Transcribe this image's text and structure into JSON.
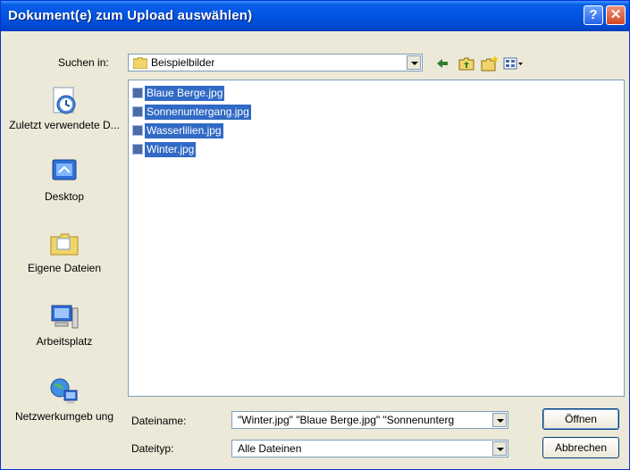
{
  "window": {
    "title": "Dokument(e) zum Upload auswählen)",
    "help_label": "?",
    "close_label": "✕"
  },
  "lookin": {
    "label": "Suchen in:",
    "value": "Beispielbilder"
  },
  "places": [
    {
      "label": "Zuletzt verwendete D...",
      "icon": "recent-documents-icon"
    },
    {
      "label": "Desktop",
      "icon": "desktop-icon"
    },
    {
      "label": "Eigene Dateien",
      "icon": "my-documents-icon"
    },
    {
      "label": "Arbeitsplatz",
      "icon": "my-computer-icon"
    },
    {
      "label": "Netzwerkumgeb ung",
      "icon": "network-places-icon"
    }
  ],
  "files": [
    "Blaue Berge.jpg",
    "Sonnenuntergang.jpg",
    "Wasserlilien.jpg",
    "Winter.jpg"
  ],
  "filename": {
    "label": "Dateiname:",
    "value": "\"Winter.jpg\" \"Blaue Berge.jpg\" \"Sonnenunterg"
  },
  "filetype": {
    "label": "Dateityp:",
    "value": "Alle Dateinen"
  },
  "buttons": {
    "open": "Öffnen",
    "cancel": "Abbrechen"
  },
  "colors": {
    "titlebar": "#0054e3",
    "selection": "#316ac5",
    "dialog_bg": "#ece9d8"
  }
}
